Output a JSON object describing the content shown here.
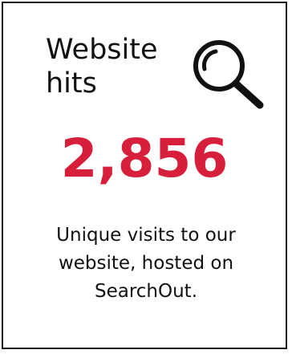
{
  "card": {
    "title_line1": "Website",
    "title_line2": "hits",
    "icon": "search-icon",
    "value": "2,856",
    "description": "Unique visits to our website, hosted on SearchOut."
  },
  "colors": {
    "accent": "#d71f3c",
    "text": "#111111",
    "border": "#111111",
    "background": "#ffffff"
  }
}
